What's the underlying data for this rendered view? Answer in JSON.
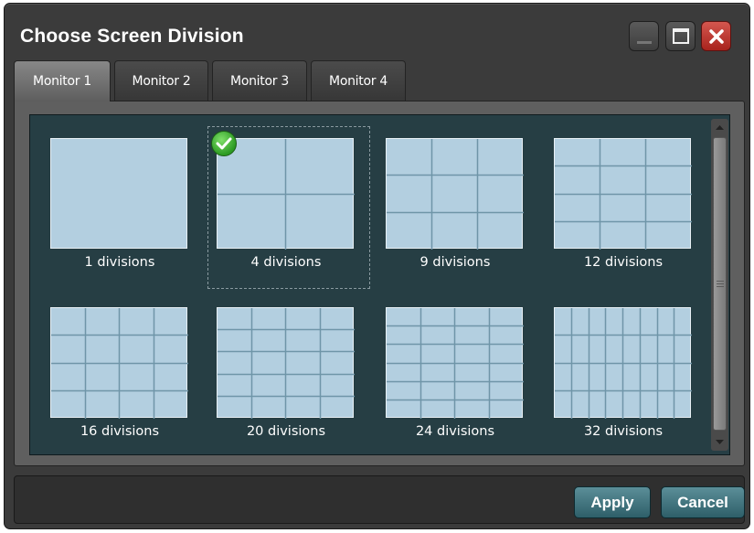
{
  "window": {
    "title": "Choose Screen Division",
    "close_color": "#c0392b"
  },
  "tabs": [
    {
      "label": "Monitor 1",
      "active": true
    },
    {
      "label": "Monitor 2",
      "active": false
    },
    {
      "label": "Monitor 3",
      "active": false
    },
    {
      "label": "Monitor 4",
      "active": false
    }
  ],
  "divisions": [
    {
      "label": "1 divisions",
      "cols": 1,
      "rows": 1,
      "selected": false
    },
    {
      "label": "4 divisions",
      "cols": 2,
      "rows": 2,
      "selected": true
    },
    {
      "label": "9 divisions",
      "cols": 3,
      "rows": 3,
      "selected": false
    },
    {
      "label": "12 divisions",
      "cols": 3,
      "rows": 4,
      "selected": false
    },
    {
      "label": "16 divisions",
      "cols": 4,
      "rows": 4,
      "selected": false
    },
    {
      "label": "20 divisions",
      "cols": 4,
      "rows": 5,
      "selected": false
    },
    {
      "label": "24 divisions",
      "cols": 4,
      "rows": 6,
      "selected": false
    },
    {
      "label": "32 divisions",
      "cols": 8,
      "rows": 4,
      "selected": false
    }
  ],
  "buttons": {
    "apply": "Apply",
    "cancel": "Cancel"
  },
  "icons": {
    "selected": "check-icon",
    "minimize": "minimize-icon",
    "maximize": "maximize-icon",
    "close": "close-icon"
  },
  "colors": {
    "preview_fill": "#b3cfe0",
    "panel_bg": "#263e44",
    "accent": "#3d717c"
  }
}
